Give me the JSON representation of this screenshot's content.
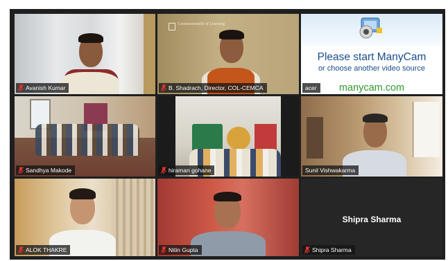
{
  "participants": [
    {
      "name": "Avanish Kumar",
      "mic": "muted"
    },
    {
      "name": "B. Shadrach, Director, COL-CEMCA",
      "mic": "muted",
      "backdrop_text": "Commonwealth of Learning"
    },
    {
      "name": "acer",
      "mic": "video-off-source",
      "overlay": {
        "line1": "Please start ManyCam",
        "line2": "or choose another video source",
        "url": "manycam.com"
      }
    },
    {
      "name": "Sandhya Makode",
      "mic": "muted"
    },
    {
      "name": "hiraman gohane",
      "mic": "muted"
    },
    {
      "name": "Sunil Vishwakarma",
      "mic": "speaking",
      "active_speaker": true
    },
    {
      "name": "ALOK THAKRE",
      "mic": "muted"
    },
    {
      "name": "Nitin Gupta",
      "mic": "muted"
    },
    {
      "name": "Shipra Sharma",
      "mic": "muted",
      "camera": "off"
    }
  ],
  "colors": {
    "grid_background": "#1f1f1f",
    "active_speaker_border": "#c8cf3a",
    "muted_mic": "#e0332b",
    "manycam_blue": "#1a4d8c",
    "manycam_green": "#2e9a2e"
  },
  "icons": {
    "mic_muted": "mic-muted-icon",
    "manycam_logo": "manycam-logo-icon"
  }
}
